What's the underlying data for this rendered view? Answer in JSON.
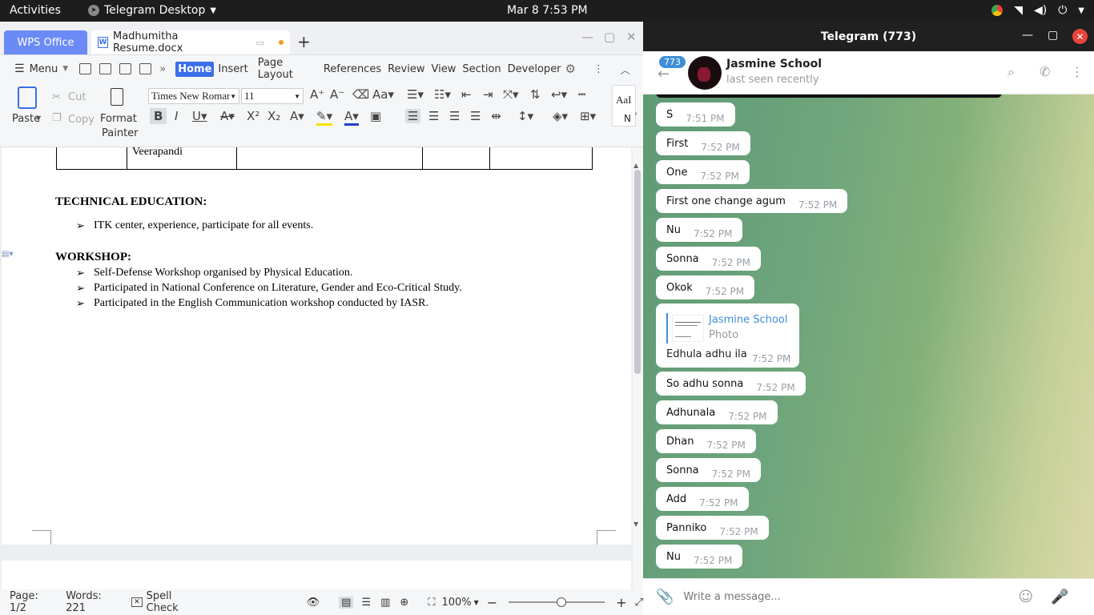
{
  "topbar": {
    "activities": "Activities",
    "app": "Telegram Desktop",
    "clock": "Mar 8   7:53 PM"
  },
  "wps": {
    "office_tab": "WPS Office",
    "doc_tab": "Madhumitha Resume.docx",
    "menu": {
      "menu_label": "Menu",
      "items": [
        "Home",
        "Insert",
        "Page Layout",
        "References",
        "Review",
        "View",
        "Section",
        "Developer"
      ]
    },
    "ribbon": {
      "paste": "Paste",
      "cut": "Cut",
      "copy": "Copy",
      "format_painter_1": "Format",
      "format_painter_2": "Painter",
      "font": "Times New Roman",
      "size": "11",
      "styles": "AaI",
      "styles2": "N"
    },
    "doc": {
      "table_cell": "Veerapandi",
      "h_technical": "TECHNICAL EDUCATION:",
      "technical_items": [
        "ITK center, experience, participate for all events."
      ],
      "h_workshop": "WORKSHOP:",
      "workshop_items": [
        "Self-Defense Workshop organised by Physical Education.",
        "Participated in National Conference on Literature, Gender and Eco-Critical Study.",
        "Participated in the English Communication workshop conducted by IASR."
      ],
      "bullet": "➢"
    },
    "status": {
      "page": "Page: 1/2",
      "words": "Words: 221",
      "spell": "Spell Check",
      "zoom": "100%"
    }
  },
  "telegram": {
    "title": "Telegram (773)",
    "badge": "773",
    "contact": "Jasmine School",
    "last_seen": "last seen recently",
    "messages": [
      {
        "text": "S",
        "time": "7:51 PM"
      },
      {
        "text": "First",
        "time": "7:52 PM"
      },
      {
        "text": "One",
        "time": "7:52 PM"
      },
      {
        "text": "First one change agum",
        "time": "7:52 PM"
      },
      {
        "text": "Nu",
        "time": "7:52 PM"
      },
      {
        "text": "Sonna",
        "time": "7:52 PM"
      },
      {
        "text": "Okok",
        "time": "7:52 PM"
      }
    ],
    "reply": {
      "name": "Jasmine School",
      "kind": "Photo",
      "text": "Edhula adhu ila",
      "time": "7:52 PM"
    },
    "messages2": [
      {
        "text": "So adhu sonna",
        "time": "7:52 PM"
      },
      {
        "text": "Adhunala",
        "time": "7:52 PM"
      },
      {
        "text": "Dhan",
        "time": "7:52 PM"
      },
      {
        "text": "Sonna",
        "time": "7:52 PM"
      },
      {
        "text": "Add",
        "time": "7:52 PM"
      },
      {
        "text": "Panniko",
        "time": "7:52 PM"
      },
      {
        "text": "Nu",
        "time": "7:52 PM"
      }
    ],
    "input_placeholder": "Write a message..."
  }
}
